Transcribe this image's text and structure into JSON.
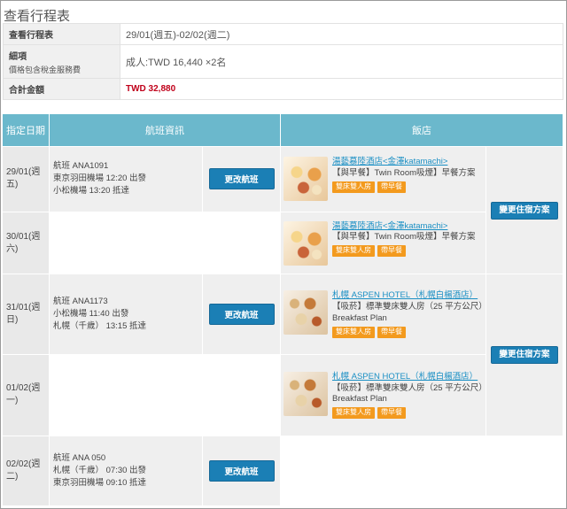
{
  "page": {
    "title": "查看行程表"
  },
  "summary": {
    "schedule_label": "查看行程表",
    "schedule_value": "29/01(週五)-02/02(週二)",
    "detail_label": "細項",
    "detail_sublabel": "價格包含稅金服務費",
    "detail_value": "成人:TWD 16,440 ×2名",
    "total_label": "合計金額",
    "total_value": "TWD 32,880"
  },
  "table": {
    "headers": {
      "date": "指定日期",
      "flight": "航班資訊",
      "hotel": "飯店"
    },
    "change_flight_label": "更改航班",
    "change_stay_label": "變更住宿方案",
    "tag_room": "雙床雙人房",
    "tag_breakfast": "帶早餐"
  },
  "rows": [
    {
      "date": "29/01(週五)",
      "flight": {
        "name": "航班 ANA1091",
        "depart": "東京羽田機場 12:20 出發",
        "arrive": "小松機場 13:20 抵達"
      },
      "hotel": {
        "name": "湯藝慕陸酒店<金澤katamachi>",
        "plan": "【與早餐】Twin Room吸煙】早餐方案"
      }
    },
    {
      "date": "30/01(週六)",
      "hotel": {
        "name": "湯藝慕陸酒店<金澤katamachi>",
        "plan": "【與早餐】Twin Room吸煙】早餐方案"
      }
    },
    {
      "date": "31/01(週日)",
      "flight": {
        "name": "航班 ANA1173",
        "depart": "小松機場 11:40 出發",
        "arrive": "札幌（千歲） 13:15 抵達"
      },
      "hotel": {
        "name": "札幌 ASPEN HOTEL（札幌白楊酒店）",
        "plan": "【吸菸】標準雙床雙人房（25 平方公尺）Breakfast Plan"
      }
    },
    {
      "date": "01/02(週一)",
      "hotel": {
        "name": "札幌 ASPEN HOTEL（札幌白楊酒店）",
        "plan": "【吸菸】標準雙床雙人房（25 平方公尺）Breakfast Plan"
      }
    },
    {
      "date": "02/02(週二)",
      "flight": {
        "name": "航班 ANA 050",
        "depart": "札幌（千歲） 07:30 出發",
        "arrive": "東京羽田機場 09:10 抵達"
      }
    }
  ]
}
